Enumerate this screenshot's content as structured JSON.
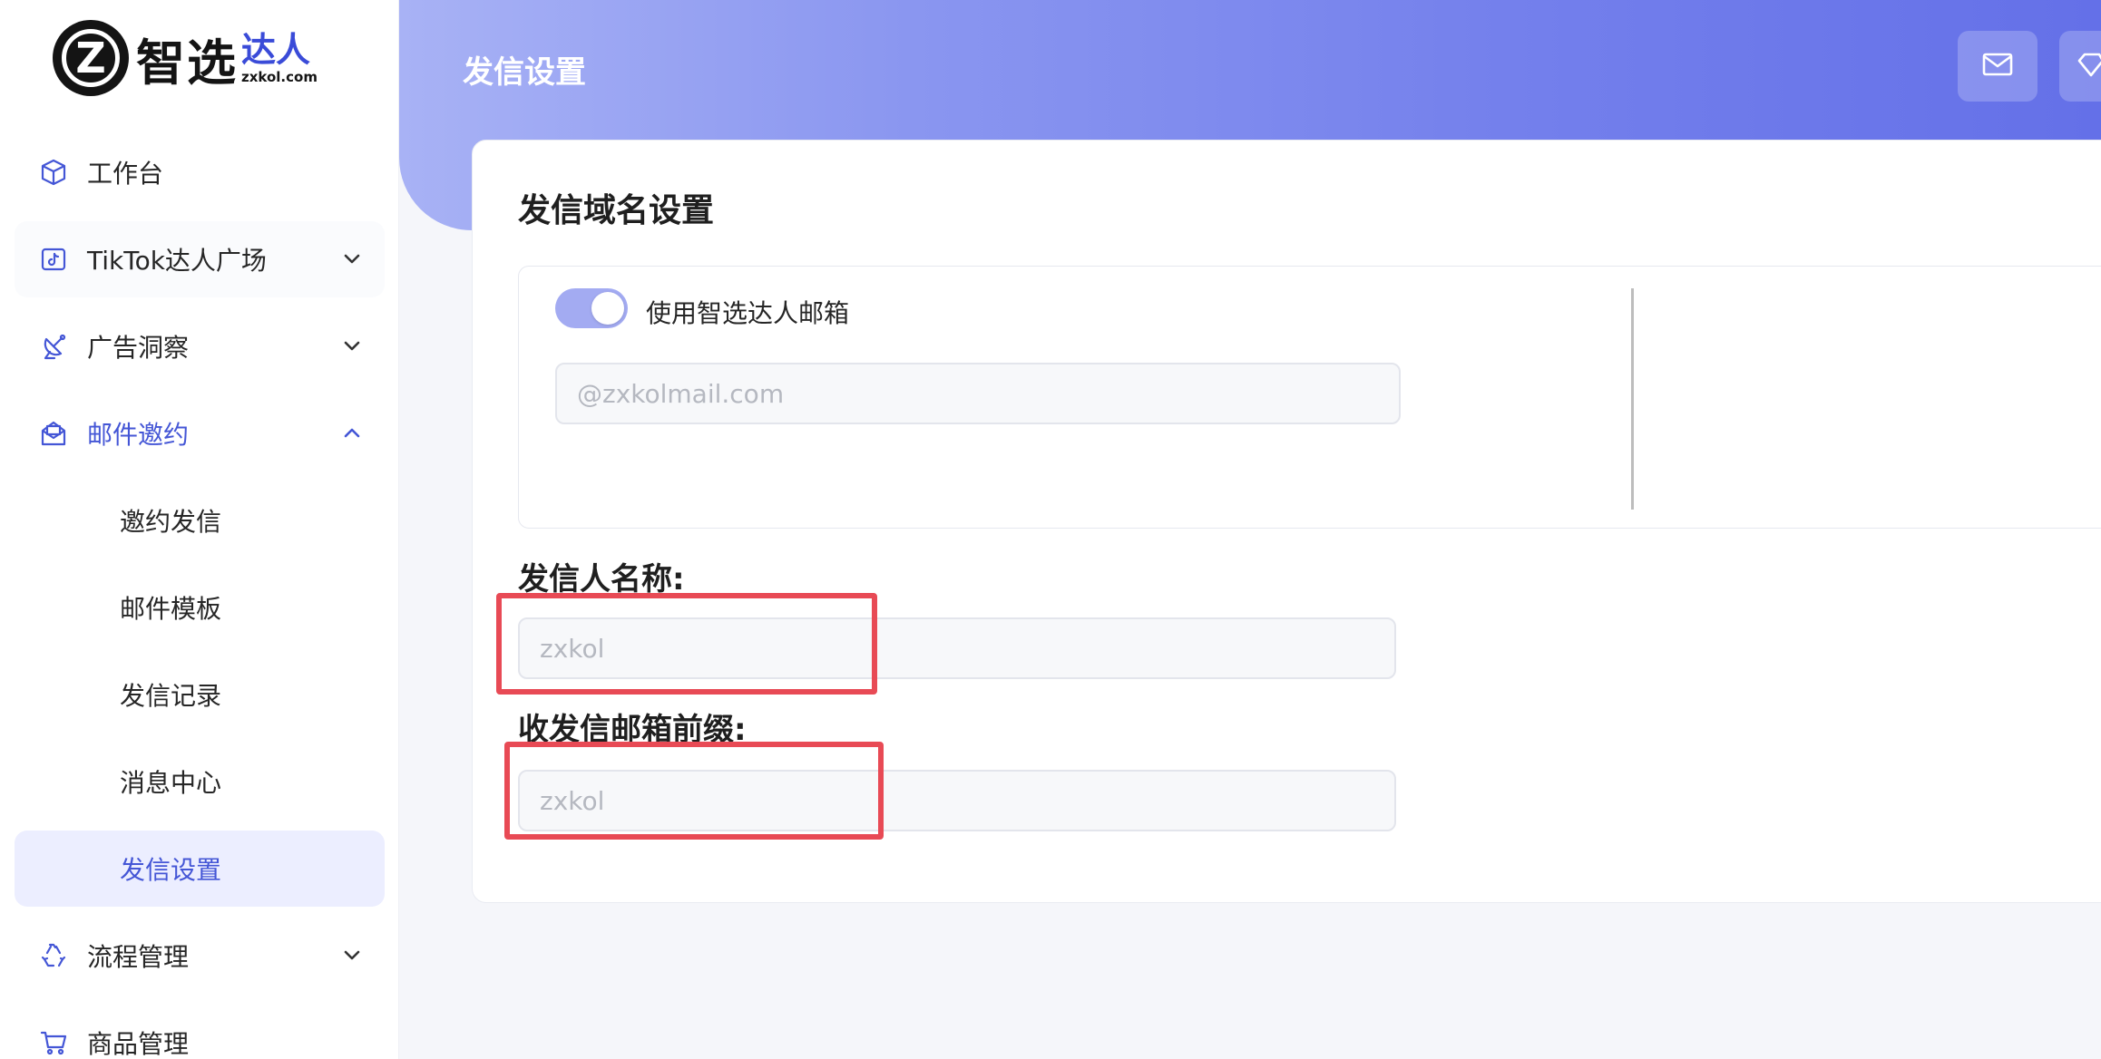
{
  "brand": {
    "mark": "Z",
    "name_part1": "智选",
    "name_part2": "达人",
    "domain": "zxkol.com"
  },
  "sidebar": {
    "items": [
      {
        "label": "工作台",
        "icon": "cube-icon"
      },
      {
        "label": "TikTok达人广场",
        "icon": "tiktok-icon"
      },
      {
        "label": "广告洞察",
        "icon": "satellite-icon"
      },
      {
        "label": "邮件邀约",
        "icon": "mail-open-icon"
      },
      {
        "label": "邀约发信"
      },
      {
        "label": "邮件模板"
      },
      {
        "label": "发信记录"
      },
      {
        "label": "消息中心"
      },
      {
        "label": "发信设置"
      },
      {
        "label": "流程管理",
        "icon": "recycle-icon"
      },
      {
        "label": "商品管理",
        "icon": "cart-icon"
      }
    ]
  },
  "header": {
    "title": "发信设置"
  },
  "main": {
    "section_title": "发信域名设置",
    "toggle_label": "使用智选达人邮箱",
    "toggle_on": true,
    "domain_placeholder": "@zxkolmail.com",
    "sender_label": "发信人名称:",
    "sender_placeholder": "zxkol",
    "prefix_label": "收发信邮箱前缀:",
    "prefix_placeholder": "zxkol"
  },
  "colors": {
    "accent": "#4456d6",
    "highlight": "#e84a55",
    "toggle": "#a3abf2"
  }
}
